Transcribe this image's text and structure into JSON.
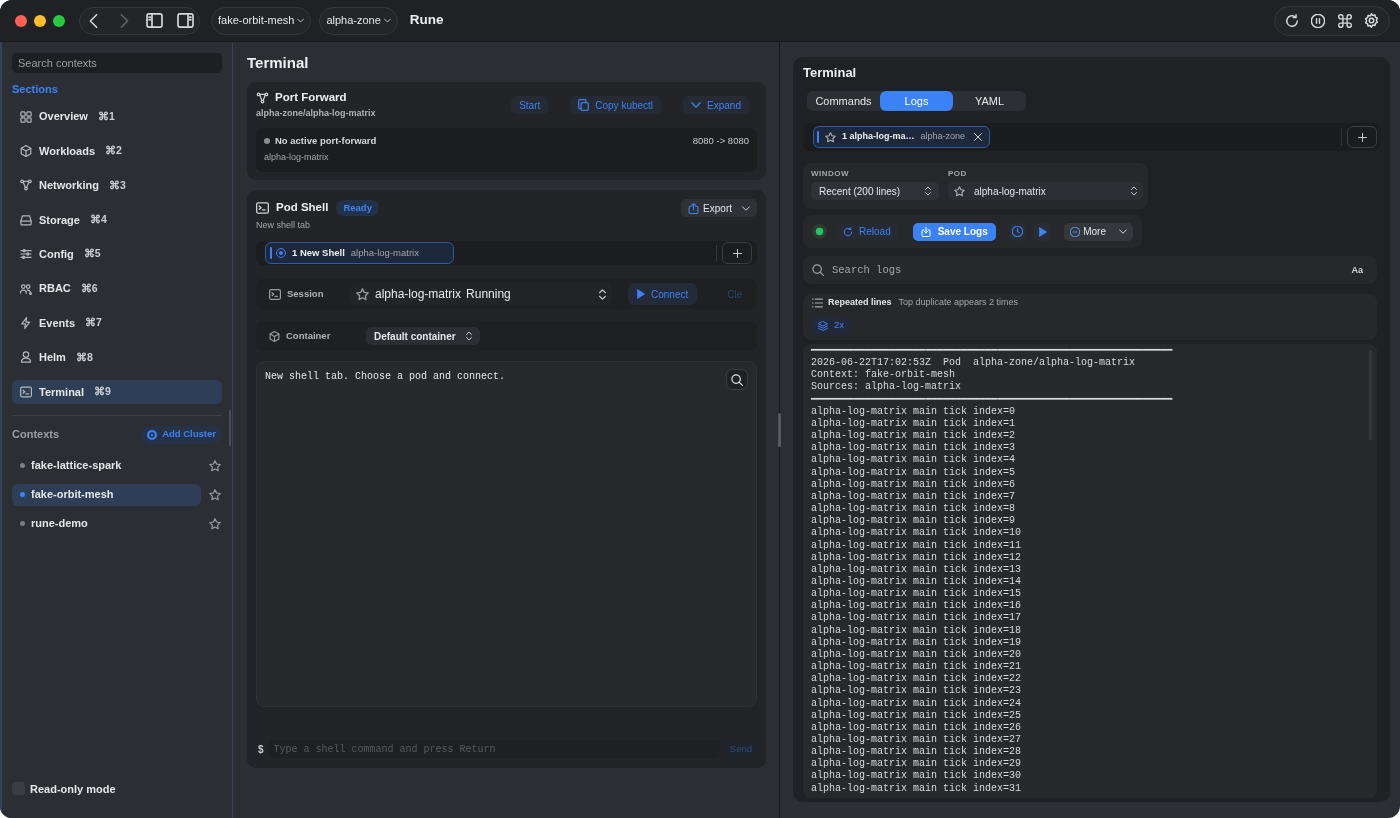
{
  "window": {
    "title": "Rune"
  },
  "toolbar": {
    "navigation": {
      "back": {
        "disabled": false
      },
      "forward": {
        "disabled": true
      }
    },
    "context_menu": {
      "label": "fake-orbit-mesh"
    },
    "namespace_menu": {
      "label": "alpha-zone"
    }
  },
  "sidebar": {
    "search": {
      "placeholder": "Search contexts"
    },
    "sections_heading": "Sections",
    "sections": [
      {
        "label": "Overview",
        "shortcut": "⌘1",
        "selected": false
      },
      {
        "label": "Workloads",
        "shortcut": "⌘2",
        "selected": false
      },
      {
        "label": "Networking",
        "shortcut": "⌘3",
        "selected": false
      },
      {
        "label": "Storage",
        "shortcut": "⌘4",
        "selected": false
      },
      {
        "label": "Config",
        "shortcut": "⌘5",
        "selected": false
      },
      {
        "label": "RBAC",
        "shortcut": "⌘6",
        "selected": false
      },
      {
        "label": "Events",
        "shortcut": "⌘7",
        "selected": false
      },
      {
        "label": "Helm",
        "shortcut": "⌘8",
        "selected": false
      },
      {
        "label": "Terminal",
        "shortcut": "⌘9",
        "selected": true
      }
    ],
    "contexts_heading": "Contexts",
    "add_button": "Add Cluster",
    "contexts": [
      {
        "label": "fake-lattice-spark",
        "selected": false,
        "starred": false
      },
      {
        "label": "fake-orbit-mesh",
        "selected": true,
        "starred": false
      },
      {
        "label": "rune-demo",
        "selected": false,
        "starred": false
      }
    ],
    "read_only": {
      "label": "Read-only mode",
      "checked": false
    }
  },
  "main": {
    "title": "Terminal",
    "port_forward": {
      "title": "Port Forward",
      "target": "alpha-zone/alpha-log-matrix",
      "actions": [
        {
          "label": "Start",
          "kind": "plain"
        },
        {
          "label": "Copy kubectl",
          "kind": "copy"
        },
        {
          "label": "Expand",
          "kind": "expand"
        }
      ],
      "status": {
        "text": "No active port-forward",
        "active": false,
        "pod": "alpha-log-matrix",
        "ports": "8080 -> 8080"
      }
    },
    "pod_shell": {
      "title": "Pod Shell",
      "badge": "Ready",
      "subtitle": "New shell tab",
      "export_button": "Export",
      "tabs": [
        {
          "label": "1 New Shell",
          "pod": "alpha-log-matrix",
          "selected": true
        }
      ],
      "session": {
        "label": "Session",
        "starred": false,
        "pod": "alpha-log-matrix",
        "status": "Running",
        "connect_button": "Connect",
        "extra_button": {
          "label": "Cle",
          "disabled": true
        }
      },
      "container": {
        "label": "Container",
        "value": "Default container"
      },
      "output": [
        "New shell tab. Choose a pod and connect."
      ],
      "command": {
        "prompt": "$",
        "placeholder": "Type a shell command and press Return",
        "send_button": {
          "label": "Send",
          "disabled": true
        }
      }
    }
  },
  "logs_panel": {
    "title": "Terminal",
    "tabs": [
      {
        "label": "Commands",
        "selected": false
      },
      {
        "label": "Logs",
        "selected": true
      },
      {
        "label": "YAML",
        "selected": false
      }
    ],
    "log_tabs": [
      {
        "label": "1 alpha-log-ma…",
        "namespace": "alpha-zone",
        "starred": false,
        "selected": true
      }
    ],
    "window": {
      "label": "WINDOW",
      "value": "Recent (200 lines)"
    },
    "pod": {
      "label": "POD",
      "value": "alpha-log-matrix",
      "starred": false
    },
    "actions": {
      "streaming": true,
      "reload": "Reload",
      "save": "Save Logs",
      "more": "More"
    },
    "search": {
      "placeholder": "Search logs",
      "case_toggle": "Aa"
    },
    "repeated": {
      "title": "Repeated lines",
      "detail": "Top duplicate appears 2 times",
      "count": "2x"
    },
    "lines": [
      "━━━━━━━━━━━━━━━━━━━━━━━━━━━━━━━━━━━━━━━━━━━━━━━━━━━━━━━━━━━━",
      "2026-06-22T17:02:53Z  Pod  alpha-zone/alpha-log-matrix",
      "Context: fake-orbit-mesh",
      "Sources: alpha-log-matrix",
      "━━━━━━━━━━━━━━━━━━━━━━━━━━━━━━━━━━━━━━━━━━━━━━━━━━━━━━━━━━━━",
      "alpha-log-matrix main tick index=0",
      "alpha-log-matrix main tick index=1",
      "alpha-log-matrix main tick index=2",
      "alpha-log-matrix main tick index=3",
      "alpha-log-matrix main tick index=4",
      "alpha-log-matrix main tick index=5",
      "alpha-log-matrix main tick index=6",
      "alpha-log-matrix main tick index=7",
      "alpha-log-matrix main tick index=8",
      "alpha-log-matrix main tick index=9",
      "alpha-log-matrix main tick index=10",
      "alpha-log-matrix main tick index=11",
      "alpha-log-matrix main tick index=12",
      "alpha-log-matrix main tick index=13",
      "alpha-log-matrix main tick index=14",
      "alpha-log-matrix main tick index=15",
      "alpha-log-matrix main tick index=16",
      "alpha-log-matrix main tick index=17",
      "alpha-log-matrix main tick index=18",
      "alpha-log-matrix main tick index=19",
      "alpha-log-matrix main tick index=20",
      "alpha-log-matrix main tick index=21",
      "alpha-log-matrix main tick index=22",
      "alpha-log-matrix main tick index=23",
      "alpha-log-matrix main tick index=24",
      "alpha-log-matrix main tick index=25",
      "alpha-log-matrix main tick index=26",
      "alpha-log-matrix main tick index=27",
      "alpha-log-matrix main tick index=28",
      "alpha-log-matrix main tick index=29",
      "alpha-log-matrix main tick index=30",
      "alpha-log-matrix main tick index=31"
    ]
  }
}
